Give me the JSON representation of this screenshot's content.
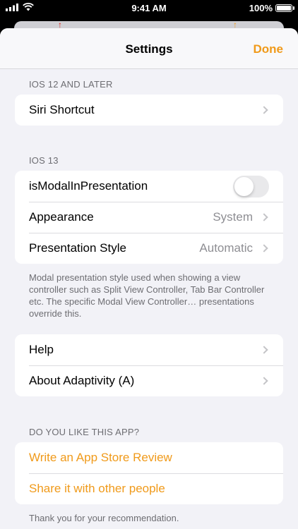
{
  "status_bar": {
    "time": "9:41 AM",
    "battery": "100%"
  },
  "nav": {
    "title": "Settings",
    "done_label": "Done"
  },
  "sections": {
    "ios12": {
      "header": "IOS 12 AND LATER",
      "rows": [
        {
          "label": "Siri Shortcut"
        }
      ]
    },
    "ios13": {
      "header": "IOS 13",
      "rows": [
        {
          "label": "isModalInPresentation",
          "toggle_on": false
        },
        {
          "label": "Appearance",
          "value": "System"
        },
        {
          "label": "Presentation Style",
          "value": "Automatic"
        }
      ],
      "footer": "Modal presentation style used when showing a view controller such as Split View Controller, Tab Bar Controller etc. The specific Modal View Controller… presentations override this."
    },
    "info": {
      "rows": [
        {
          "label": "Help"
        },
        {
          "label": "About Adaptivity (A)"
        }
      ]
    },
    "like": {
      "header": "DO YOU LIKE THIS APP?",
      "rows": [
        {
          "label": "Write an App Store Review"
        },
        {
          "label": "Share it with other people"
        }
      ],
      "footer": "Thank you for your recommendation."
    }
  },
  "colors": {
    "accent": "#f09a1a",
    "background": "#f2f2f7",
    "secondary_text": "#6d6d72"
  },
  "icons": {
    "row_disclosure": "chevron-right-icon",
    "red_marker": "arrow-up-icon",
    "orange_marker": "arrow-up-icon"
  }
}
